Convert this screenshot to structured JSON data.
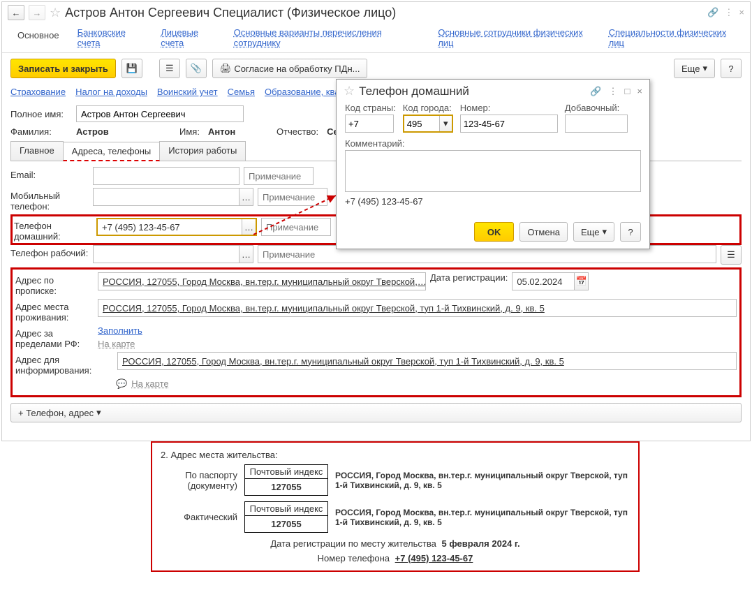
{
  "title": "Астров Антон Сергеевич Специалист (Физическое лицо)",
  "nav": {
    "main": "Основное",
    "bank": "Банковские счета",
    "personal": "Лицевые счета",
    "transfer": "Основные варианты перечисления сотруднику",
    "employees": "Основные сотрудники физических лиц",
    "specialties": "Специальности физических лиц"
  },
  "toolbar": {
    "save_close": "Записать и закрыть",
    "consent": "Согласие на обработку ПДн...",
    "more": "Еще"
  },
  "sublinks": {
    "insurance": "Страхование",
    "tax": "Налог на доходы",
    "military": "Воинский учет",
    "family": "Семья",
    "education": "Образование, ква"
  },
  "form": {
    "fullname_label": "Полное имя:",
    "fullname": "Астров Антон Сергеевич",
    "surname_label": "Фамилия:",
    "surname": "Астров",
    "name_label": "Имя:",
    "name": "Антон",
    "patronymic_label": "Отчество:",
    "patronymic": "Сер"
  },
  "tabs": {
    "main": "Главное",
    "addresses": "Адреса, телефоны",
    "history": "История работы"
  },
  "contacts": {
    "email_label": "Email:",
    "mobile_label": "Мобильный телефон:",
    "home_label": "Телефон домашний:",
    "home_value": "+7 (495) 123-45-67",
    "work_label": "Телефон рабочий:",
    "note_placeholder": "Примечание"
  },
  "addresses": {
    "reg_label": "Адрес по прописке:",
    "reg_value": "РОССИЯ, 127055, Город Москва, вн.тер.г. муниципальный округ Тверской,…",
    "reg_date_label": "Дата регистрации:",
    "reg_date": "05.02.2024",
    "live_label": "Адрес места проживания:",
    "live_value": "РОССИЯ, 127055, Город Москва, вн.тер.г. муниципальный округ Тверской, туп 1-й Тихвинский, д. 9, кв. 5",
    "abroad_label": "Адрес за пределами РФ:",
    "fill": "Заполнить",
    "on_map": "На карте",
    "info_label": "Адрес для информирования:",
    "info_value": "РОССИЯ, 127055, Город Москва, вн.тер.г. муниципальный округ Тверской, туп 1-й Тихвинский, д. 9, кв. 5",
    "add_btn": "+ Телефон, адрес"
  },
  "popup": {
    "title": "Телефон домашний",
    "country_label": "Код страны:",
    "country": "+7",
    "city_label": "Код города:",
    "city": "495",
    "number_label": "Номер:",
    "number": "123-45-67",
    "ext_label": "Добавочный:",
    "comment_label": "Комментарий:",
    "display": "+7 (495) 123-45-67",
    "ok": "OK",
    "cancel": "Отмена",
    "more": "Еще"
  },
  "snippet": {
    "heading": "2. Адрес места жительства:",
    "index_label": "Почтовый индекс",
    "index": "127055",
    "passport_label": "По паспорту (документу)",
    "actual_label": "Фактический",
    "address_text": "РОССИЯ,   Город Москва, вн.тер.г. муниципальный округ Тверской, туп 1-й Тихвинский, д. 9, кв. 5",
    "reg_text_prefix": "Дата регистрации по месту жительства",
    "reg_text_date": "5 февраля 2024 г.",
    "phone_prefix": "Номер телефона",
    "phone": "+7 (495) 123-45-67"
  }
}
